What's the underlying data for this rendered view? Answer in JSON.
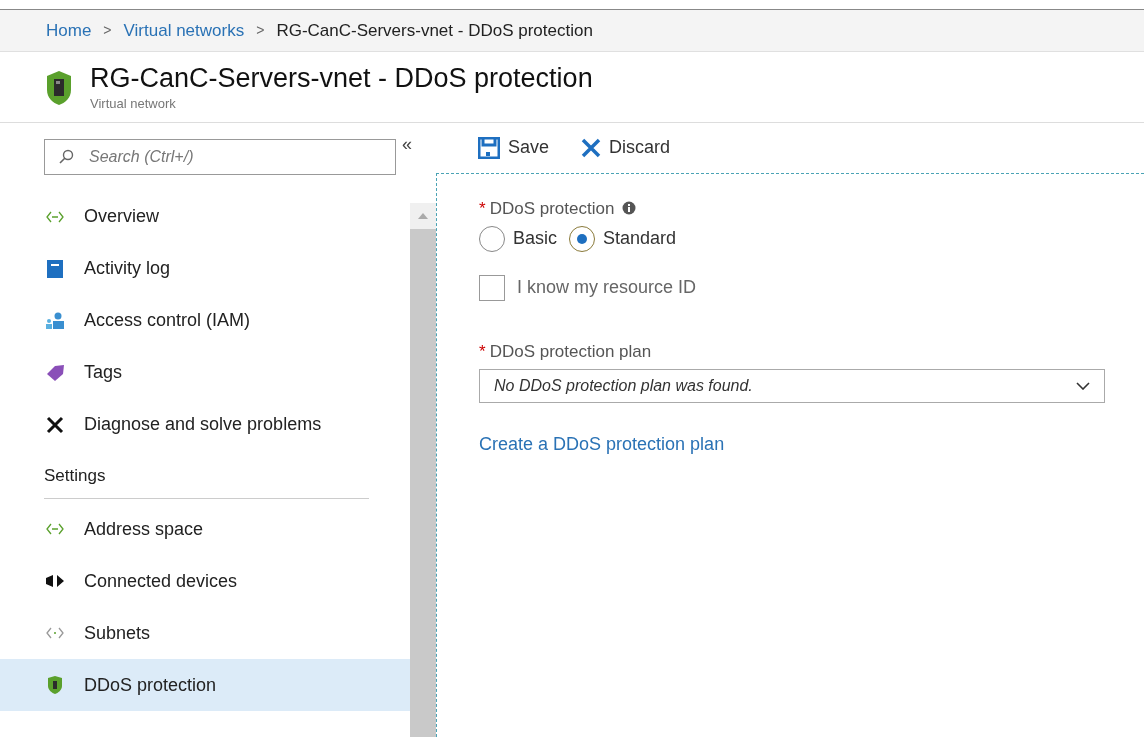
{
  "breadcrumb": [
    {
      "label": "Home",
      "link": true
    },
    {
      "label": "Virtual networks",
      "link": true
    },
    {
      "label": "RG-CanC-Servers-vnet - DDoS protection",
      "link": false
    }
  ],
  "breadcrumb_separator": ">",
  "header": {
    "title": "RG-CanC-Servers-vnet - DDoS protection",
    "subtitle": "Virtual network"
  },
  "sidebar": {
    "search": {
      "placeholder": "Search (Ctrl+/)"
    },
    "collapse": "«",
    "items": [
      {
        "label": "Overview",
        "selected": false
      },
      {
        "label": "Activity log",
        "selected": false
      },
      {
        "label": "Access control (IAM)",
        "selected": false
      },
      {
        "label": "Tags",
        "selected": false
      },
      {
        "label": "Diagnose and solve problems",
        "selected": false
      }
    ],
    "section": "Settings",
    "settings_items": [
      {
        "label": "Address space",
        "selected": false
      },
      {
        "label": "Connected devices",
        "selected": false
      },
      {
        "label": "Subnets",
        "selected": false
      },
      {
        "label": "DDoS protection",
        "selected": true
      }
    ]
  },
  "toolbar": [
    {
      "label": "Save"
    },
    {
      "label": "Discard"
    }
  ],
  "form": {
    "protection": {
      "label": "DDoS protection",
      "required_mark": "*",
      "options": [
        {
          "label": "Basic",
          "selected": false
        },
        {
          "label": "Standard",
          "selected": true
        }
      ]
    },
    "resource_id": {
      "label": "I know my resource ID",
      "checked": false
    },
    "plan": {
      "label": "DDoS protection plan",
      "required_mark": "*",
      "value": "No DDoS protection plan was found."
    },
    "create_link": "Create a DDoS protection plan"
  }
}
